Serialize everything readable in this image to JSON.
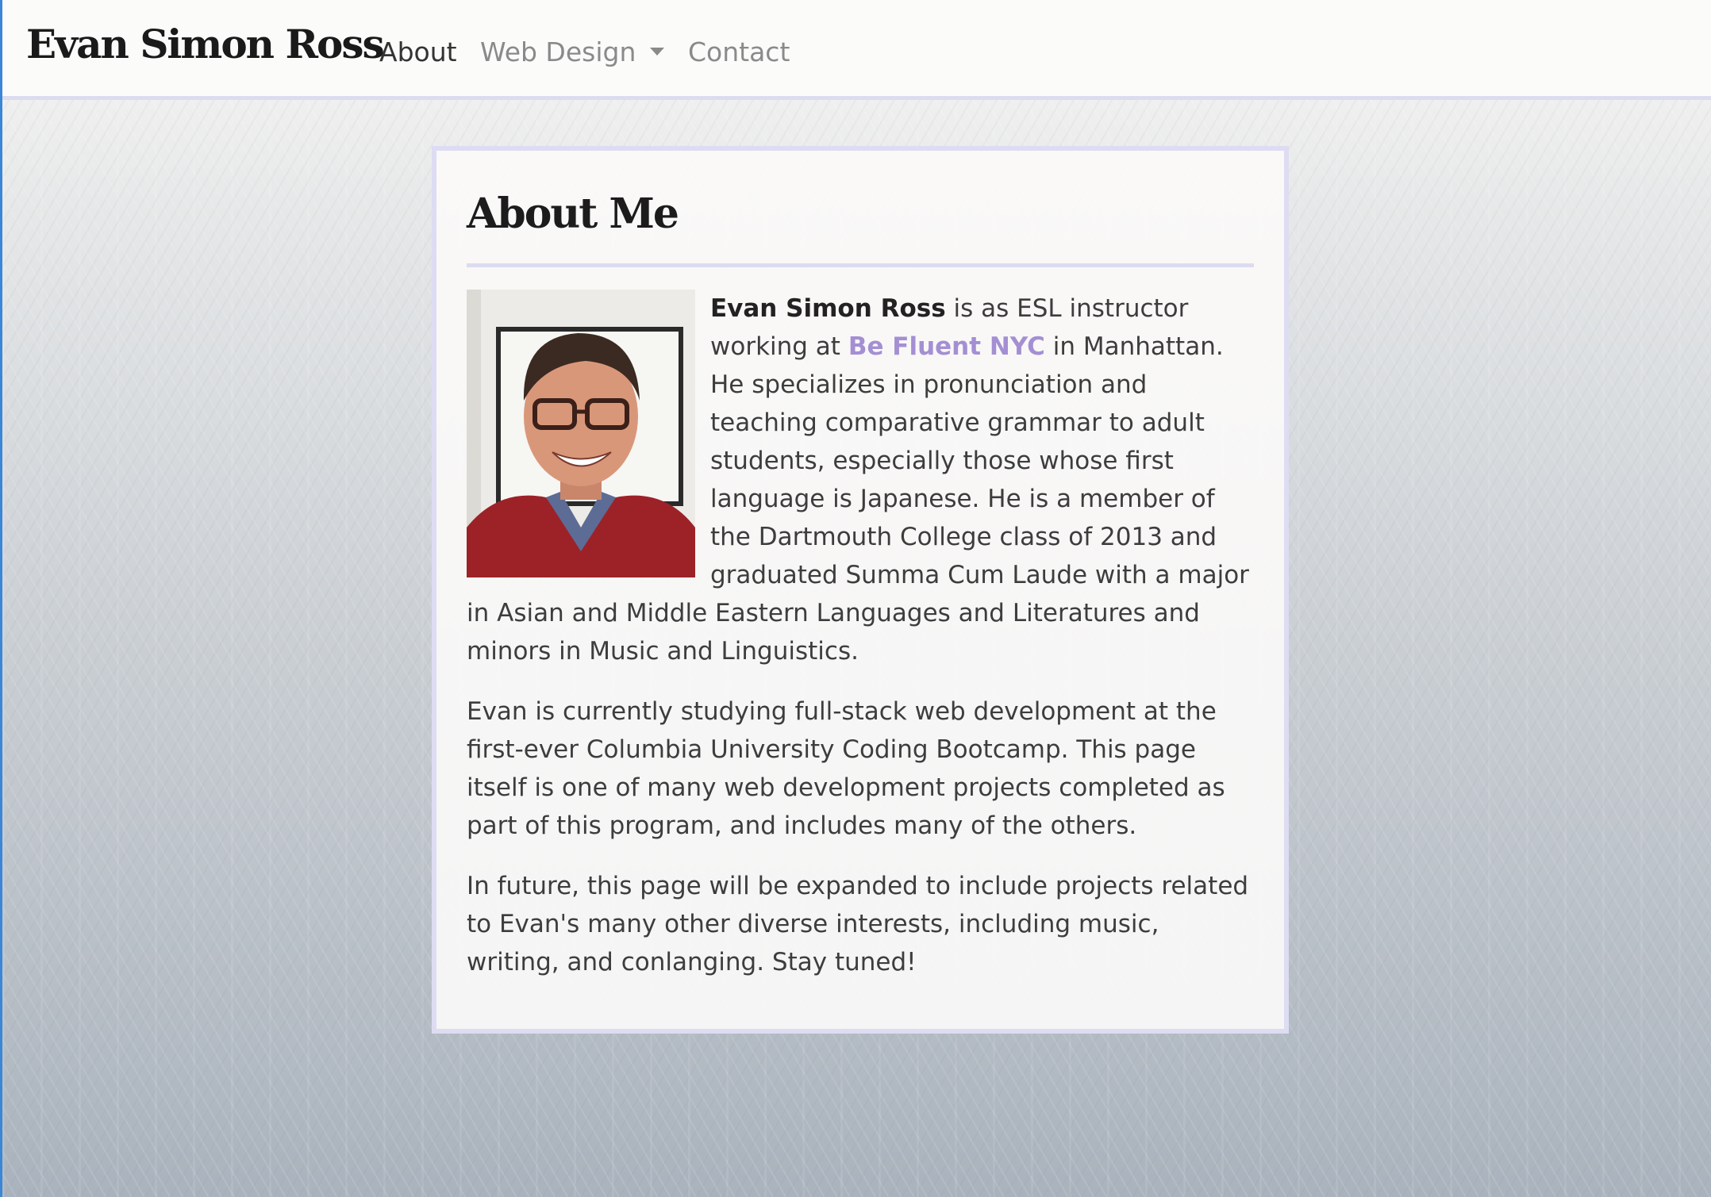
{
  "navbar": {
    "brand": "Evan Simon Ross",
    "links": [
      {
        "label": "About",
        "active": true
      },
      {
        "label": "Web Design",
        "dropdown": true
      },
      {
        "label": "Contact"
      }
    ]
  },
  "about": {
    "title": "About Me",
    "para1": {
      "name": "Evan Simon Ross",
      "text_a": " is as ESL instructor working at ",
      "link": "Be Fluent NYC",
      "text_b": " in Manhattan. He specializes in pronunciation and teaching comparative grammar to adult students, especially those whose first language is Japanese. He is a member of the Dartmouth College class of 2013 and graduated Summa Cum Laude with a major in Asian and Middle Eastern Languages and Literatures and minors in Music and Linguistics."
    },
    "para2": "Evan is currently studying full-stack web development at the first-ever Columbia University Coding Bootcamp. This page itself is one of many web development projects completed as part of this program, and includes many of the others.",
    "para3": "In future, this page will be expanded to include projects related to Evan's many other diverse interests, including music, writing, and conlanging. Stay tuned!"
  },
  "colors": {
    "accent_link": "#a48fd3",
    "border": "#dddcf2",
    "edge": "#3b86d6"
  }
}
